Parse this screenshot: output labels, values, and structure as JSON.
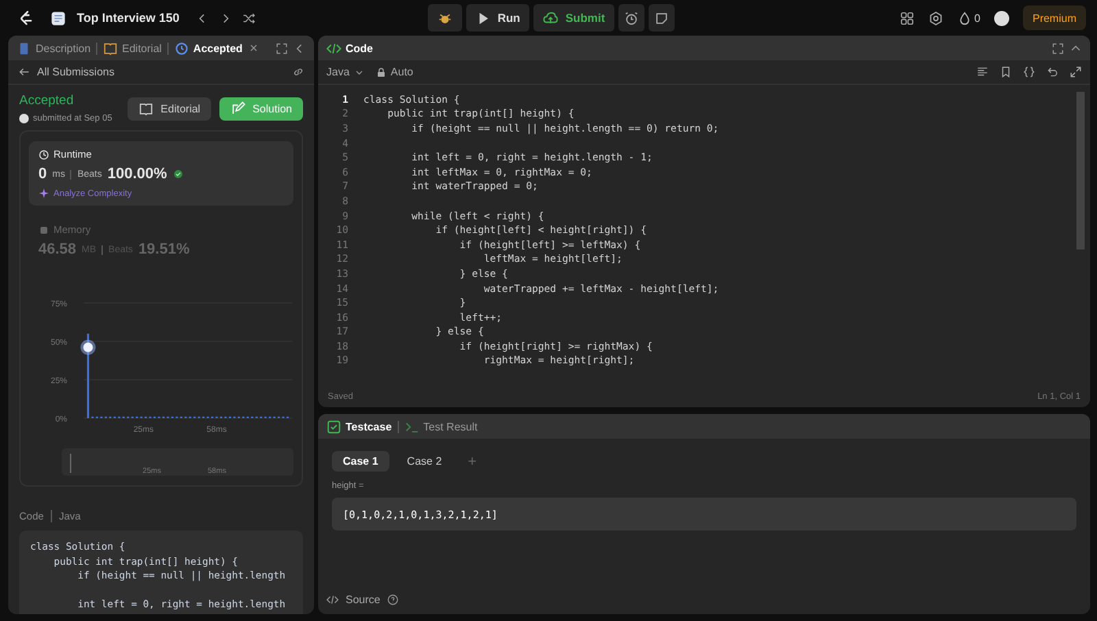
{
  "topbar": {
    "title": "Top Interview 150",
    "run": "Run",
    "submit": "Submit",
    "streak": "0",
    "premium": "Premium"
  },
  "left_panel": {
    "tabs": [
      {
        "label": "Description",
        "selected": false
      },
      {
        "label": "Editorial",
        "selected": false
      },
      {
        "label": "Accepted",
        "selected": true
      }
    ],
    "back_link": "All Submissions",
    "submission": {
      "status": "Accepted",
      "submitted": "submitted at Sep 05",
      "editorial_button": "Editorial",
      "solution_button": "Solution"
    },
    "metrics": [
      {
        "title": "Runtime",
        "value": "0",
        "unit": "ms",
        "beats_label": "Beats",
        "beats": "100.00%",
        "selected": true,
        "analyze": "Analyze Complexity"
      },
      {
        "title": "Memory",
        "value": "46.58",
        "unit": "MB",
        "beats_label": "Beats",
        "beats": "19.51%",
        "selected": false
      }
    ],
    "chart_data": {
      "type": "bar",
      "x": [
        0,
        2,
        4,
        6,
        8,
        10,
        12,
        14,
        16,
        18,
        20,
        22,
        24,
        26,
        28,
        30,
        32,
        34,
        36,
        38,
        40,
        42,
        44,
        46,
        48,
        50,
        52,
        54,
        56,
        58,
        60,
        62,
        64,
        66,
        68,
        70,
        72,
        74,
        76,
        78,
        80,
        82,
        84,
        86,
        88,
        90
      ],
      "series": [
        {
          "color": "#3b6fdc",
          "values": [
            55,
            1,
            1,
            1,
            1,
            1,
            1,
            1,
            1,
            1,
            1,
            1,
            1,
            1,
            1,
            1,
            1,
            1,
            1,
            1,
            1,
            1,
            1,
            1,
            1,
            1,
            1,
            1,
            1,
            1,
            1,
            1,
            1,
            1,
            1,
            1,
            1,
            1,
            1,
            1,
            1,
            1,
            1,
            1,
            1,
            1
          ]
        }
      ],
      "xlim": [
        -2,
        92
      ],
      "ylim": [
        0,
        75
      ],
      "grid": true,
      "yticks": [
        {
          "value": 0,
          "label": "0%"
        },
        {
          "value": 25,
          "label": "25%"
        },
        {
          "value": 50,
          "label": "50%"
        },
        {
          "value": 75,
          "label": "75%"
        }
      ],
      "xticks": [
        {
          "value": 25,
          "label": "25ms"
        },
        {
          "value": 58,
          "label": "58ms"
        }
      ]
    },
    "navigator": {
      "labels": [
        "25ms",
        "58ms"
      ]
    },
    "code_label": "Code",
    "code_language": "Java",
    "code_preview": "class Solution {\n    public int trap(int[] height) {\n        if (height == null || height.length\n\n        int left = 0, right = height.length"
  },
  "code_panel": {
    "title": "Code",
    "language": "Java",
    "mode": "Auto",
    "lines": [
      {
        "n": "1",
        "current": true,
        "text": "class Solution {"
      },
      {
        "n": "2",
        "current": false,
        "text": "    public int trap(int[] height) {"
      },
      {
        "n": "3",
        "current": false,
        "text": "        if (height == null || height.length == 0) return 0;"
      },
      {
        "n": "4",
        "current": false
      },
      {
        "n": "5",
        "current": false,
        "text": "        int left = 0, right = height.length - 1;"
      },
      {
        "n": "6",
        "current": false,
        "text": "        int leftMax = 0, rightMax = 0;"
      },
      {
        "n": "7",
        "current": false,
        "text": "        int waterTrapped = 0;"
      },
      {
        "n": "8",
        "current": false
      },
      {
        "n": "9",
        "current": false,
        "text": "        while (left < right) {"
      },
      {
        "n": "10",
        "current": false,
        "text": "            if (height[left] < height[right]) {"
      },
      {
        "n": "11",
        "current": false,
        "text": "                if (height[left] >= leftMax) {"
      },
      {
        "n": "12",
        "current": false,
        "text": "                    leftMax = height[left];"
      },
      {
        "n": "13",
        "current": false,
        "text": "                } else {"
      },
      {
        "n": "14",
        "current": false,
        "text": "                    waterTrapped += leftMax - height[left];"
      },
      {
        "n": "15",
        "current": false,
        "text": "                }"
      },
      {
        "n": "16",
        "current": false,
        "text": "                left++;"
      },
      {
        "n": "17",
        "current": false,
        "text": "            } else {"
      },
      {
        "n": "18",
        "current": false,
        "text": "                if (height[right] >= rightMax) {"
      },
      {
        "n": "19",
        "current": false,
        "text": "                    rightMax = height[right];"
      }
    ],
    "status": "Saved",
    "cursor": "Ln 1, Col 1"
  },
  "testcase_panel": {
    "tabs": [
      {
        "label": "Testcase",
        "selected": true
      },
      {
        "label": "Test Result",
        "selected": false
      }
    ],
    "cases": [
      {
        "label": "Case 1",
        "selected": true
      },
      {
        "label": "Case 2",
        "selected": false
      }
    ],
    "add": "+",
    "param_label": "height =",
    "param_value": "[0,1,0,2,1,0,1,3,2,1,2,1]",
    "source": "Source"
  }
}
